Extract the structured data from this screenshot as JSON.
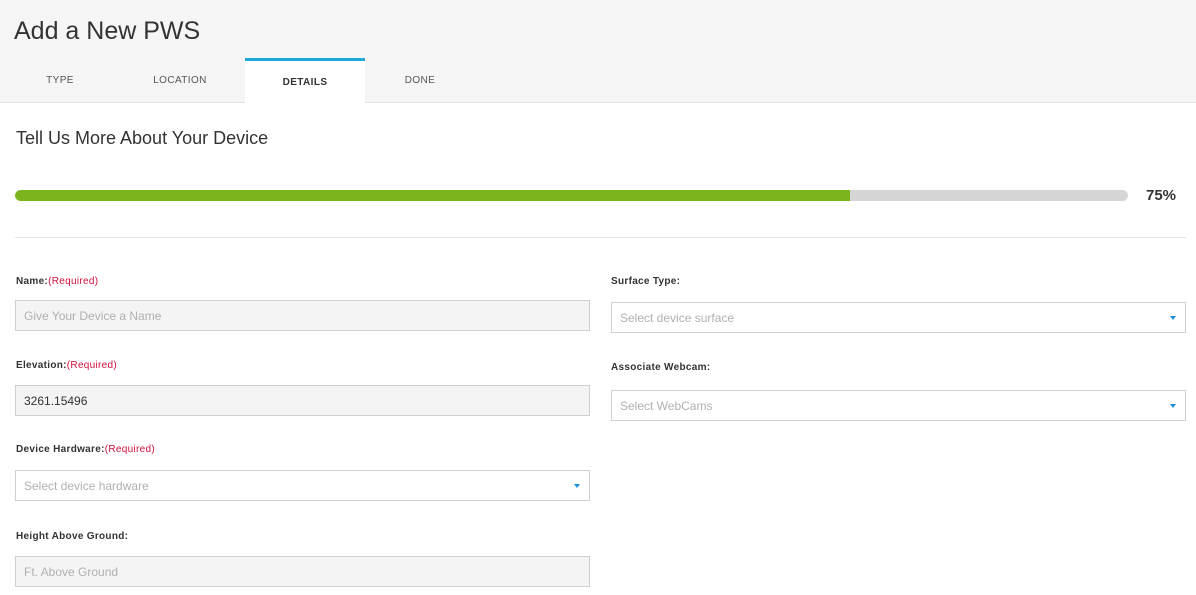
{
  "header": {
    "title": "Add a New PWS",
    "tabs": [
      {
        "label": "TYPE"
      },
      {
        "label": "LOCATION"
      },
      {
        "label": "DETAILS"
      },
      {
        "label": "DONE"
      }
    ],
    "active_tab": "DETAILS"
  },
  "section": {
    "title": "Tell Us More About Your Device"
  },
  "progress": {
    "label": "75%",
    "value": 0.75,
    "fill_color": "#7ab51d",
    "track_color": "#d5d5d5"
  },
  "form": {
    "name": {
      "label": "Name:",
      "required": "(Required)",
      "placeholder": "Give Your Device a Name"
    },
    "elevation": {
      "label": "Elevation:",
      "required": "(Required)",
      "value": "3261.15496"
    },
    "hardware": {
      "label": "Device Hardware:",
      "required": "(Required)",
      "placeholder": "Select device hardware"
    },
    "height": {
      "label": "Height Above Ground:",
      "placeholder": "Ft. Above Ground"
    },
    "surface": {
      "label": "Surface Type:",
      "placeholder": "Select device surface"
    },
    "webcam": {
      "label": "Associate Webcam:",
      "placeholder": "Select WebCams"
    }
  },
  "colors": {
    "active_tab_accent": "#1fa8d8",
    "required_text": "#d0103a",
    "dropdown_caret": "#1f8fd8"
  }
}
